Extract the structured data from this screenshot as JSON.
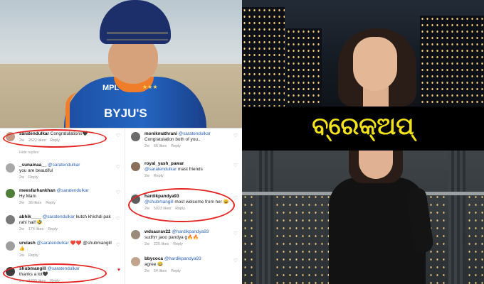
{
  "title": "ବ୍ରେକ୍‌ଅପ୍",
  "jersey": {
    "sponsor": "BYJU'S",
    "brand": "MPL"
  },
  "comments_left": [
    {
      "user": "saratendulkar",
      "text": "Congratulations🖤",
      "time": "2w",
      "likes": "2622 likes",
      "reply": "Reply"
    },
    {
      "user": "_sunainaa__",
      "mention": "@saratendulkar",
      "text": "you are beautiful",
      "time": "2w",
      "likes": "",
      "reply": "Reply"
    },
    {
      "user": "meesfarhankhan",
      "mention": "@saratendulkar",
      "text": "Hy Mam",
      "time": "2w",
      "likes": "36 likes",
      "reply": "Reply"
    },
    {
      "user": "abhik____",
      "mention": "@saratendulkar",
      "text": "kutch khichdi pak rahi hai!!🤣",
      "time": "2w",
      "likes": "174 likes",
      "reply": "Reply"
    },
    {
      "user": "urviash",
      "mention": "@saratendulkar",
      "text": "❤️❤️ @shubmangill 👍",
      "time": "2w",
      "likes": "",
      "reply": "Reply"
    },
    {
      "user": "shubmangill",
      "mention": "@saratendulkar",
      "text": "thanks a lot🖤",
      "time": "2w",
      "likes": "1299 likes",
      "reply": "Reply"
    }
  ],
  "hide_replies_label": "Hide replies",
  "comments_right": [
    {
      "user": "monikmathrani",
      "mention": "@saratendulkar",
      "text": "Congratulation both of you..",
      "time": "2w",
      "likes": "66 likes",
      "reply": "Reply"
    },
    {
      "user": "royal_yash_pawar",
      "mention": "@saratendulkar",
      "text": "mast friends",
      "time": "2w",
      "likes": "",
      "reply": "Reply"
    },
    {
      "user": "hardikpandya93",
      "mention": "@shubmangill",
      "text": "most welcome from her 😄",
      "time": "2w",
      "likes": "5023 likes",
      "reply": "Reply"
    },
    {
      "user": "wdsaurav22",
      "mention": "@hardikpandya93",
      "text": "sudhrr jaoo pandya g🔥🔥",
      "time": "2w",
      "likes": "220 likes",
      "reply": "Reply"
    },
    {
      "user": "bbycoca",
      "mention": "@hardikpandya93",
      "text": "agree 😂",
      "time": "2w",
      "likes": "54 likes",
      "reply": "Reply"
    }
  ],
  "colors": {
    "banner_text": "#f4e21a",
    "highlight": "#e52521",
    "link": "#2b63b8"
  },
  "icons": {
    "like": "heart-icon"
  }
}
